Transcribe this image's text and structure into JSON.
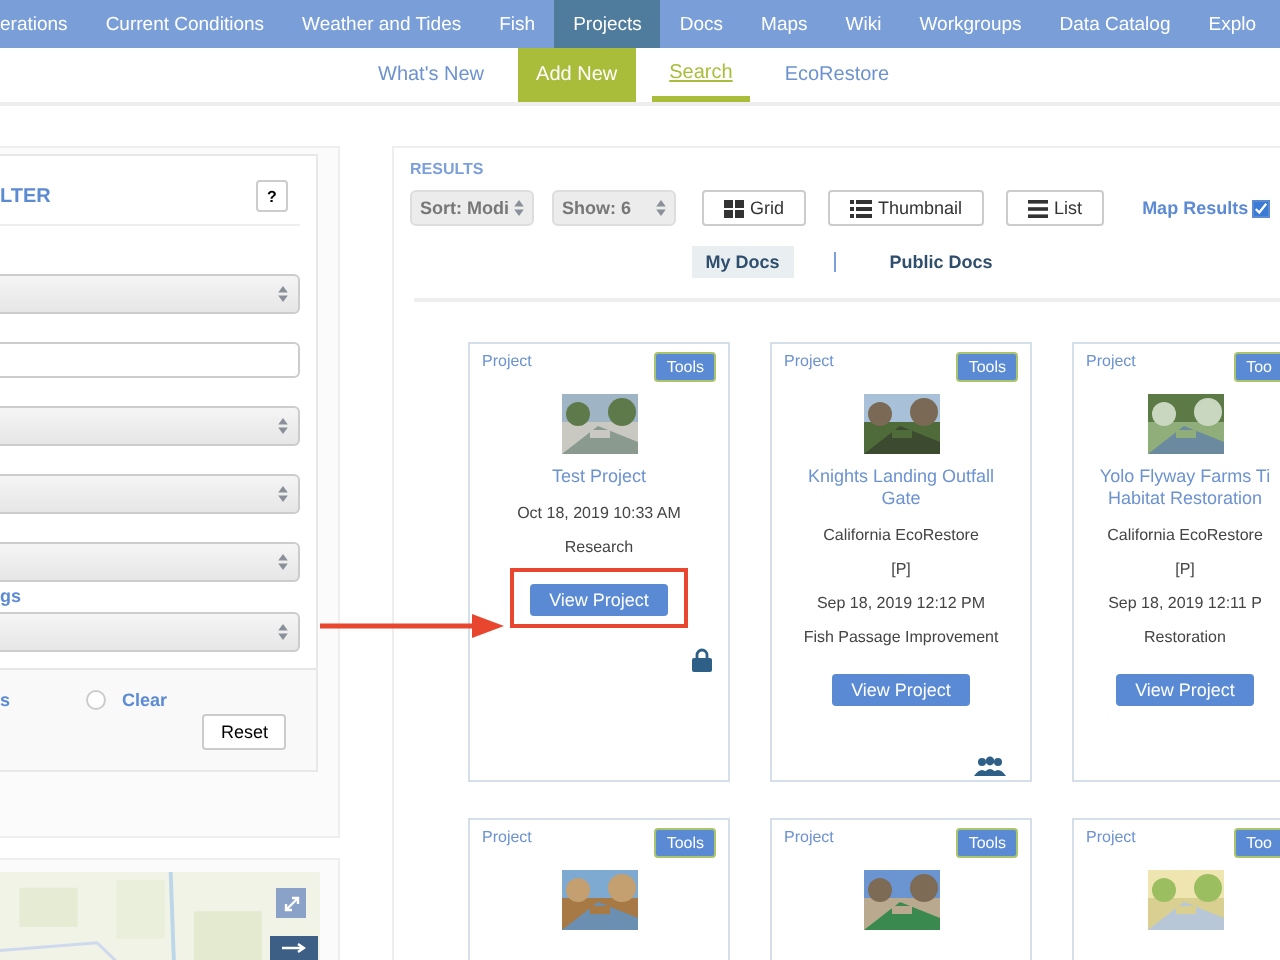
{
  "nav": [
    {
      "label": "erations",
      "selected": false
    },
    {
      "label": "Current Conditions",
      "selected": false
    },
    {
      "label": "Weather and Tides",
      "selected": false
    },
    {
      "label": "Fish",
      "selected": false
    },
    {
      "label": "Projects",
      "selected": true
    },
    {
      "label": "Docs",
      "selected": false
    },
    {
      "label": "Maps",
      "selected": false
    },
    {
      "label": "Wiki",
      "selected": false
    },
    {
      "label": "Workgroups",
      "selected": false
    },
    {
      "label": "Data Catalog",
      "selected": false
    },
    {
      "label": "Explo",
      "selected": false
    }
  ],
  "subnav": [
    {
      "label": "What's New",
      "kind": "link",
      "selected": false
    },
    {
      "label": "Add New",
      "kind": "highlight",
      "selected": false
    },
    {
      "label": "Search",
      "kind": "link",
      "selected": true
    },
    {
      "label": "EcoRestore",
      "kind": "link",
      "selected": false
    }
  ],
  "filter": {
    "title": "LTER",
    "help": "?",
    "fields": [
      {
        "kind": "select"
      },
      {
        "kind": "input"
      },
      {
        "kind": "select"
      },
      {
        "kind": "select"
      },
      {
        "kind": "select"
      },
      {
        "kind": "select",
        "label": "gs"
      }
    ],
    "link": "s",
    "clear": {
      "label": "Clear",
      "checked": false
    },
    "reset": "Reset"
  },
  "results": {
    "heading": "RESULTS",
    "sort": "Sort: Modi",
    "show": "Show: 6",
    "views": [
      {
        "label": "Grid",
        "kind": "grid"
      },
      {
        "label": "Thumbnail",
        "kind": "thumbnail"
      },
      {
        "label": "List",
        "kind": "list"
      }
    ],
    "map_results": {
      "label": "Map Results",
      "checked": true
    },
    "doc_tabs": [
      {
        "label": "My Docs",
        "selected": true
      },
      {
        "label": "Public Docs",
        "selected": false
      }
    ],
    "cards": [
      {
        "type": "Project",
        "tools": "Tools",
        "title_lines": [
          "Test Project"
        ],
        "lines": [
          "Oct 18, 2019 10:33 AM",
          "Research"
        ],
        "button": "View Project",
        "highlighted": true,
        "kind": "locked"
      },
      {
        "type": "Project",
        "tools": "Tools",
        "title_lines": [
          "Knights Landing Outfall",
          "Gate"
        ],
        "lines": [
          "California EcoRestore",
          "[P]",
          "Sep 18, 2019 12:12 PM",
          "Fish Passage Improvement"
        ],
        "button": "View Project",
        "highlighted": false,
        "kind": "shared"
      },
      {
        "type": "Project",
        "tools": "Too",
        "title_lines": [
          "Yolo Flyway Farms Ti",
          "Habitat Restoration"
        ],
        "lines": [
          "California EcoRestore",
          "[P]",
          "Sep 18, 2019 12:11 P",
          "Restoration"
        ],
        "button": "View Project",
        "highlighted": false,
        "kind": "plain"
      },
      {
        "type": "Project",
        "tools": "Tools"
      },
      {
        "type": "Project",
        "tools": "Tools"
      },
      {
        "type": "Project",
        "tools": "Too"
      }
    ]
  }
}
